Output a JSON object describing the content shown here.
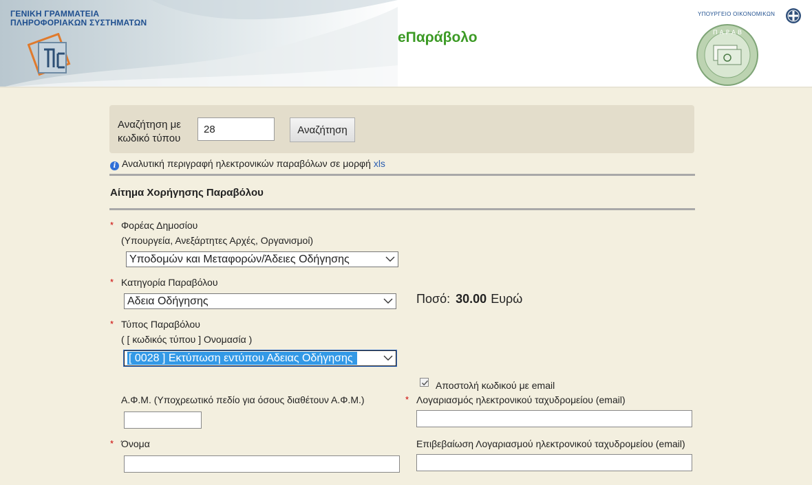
{
  "header": {
    "gsis_line1": "ΓΕΝΙΚΗ ΓΡΑΜΜΑΤΕΙΑ",
    "gsis_line2": "ΠΛΗΡΟΦΟΡΙΑΚΩΝ ΣΥΣΤΗΜΑΤΩΝ",
    "app_title": "eΠαράβολο",
    "ministry": "ΥΠΟΥΡΓΕΙΟ ΟΙΚΟΝΟΜΙΚΩΝ"
  },
  "search": {
    "label_line1": "Αναζήτηση με",
    "label_line2": "κωδικό τύπου",
    "value": "28",
    "button": "Αναζήτηση"
  },
  "info": {
    "text": "Αναλυτική περιγραφή ηλεκτρονικών παραβόλων σε μορφή",
    "link": "xls"
  },
  "section_title": "Αίτημα Χορήγησης Παραβόλου",
  "form": {
    "agency": {
      "label": "Φορέας Δημοσίου",
      "hint": "(Υπουργεία, Ανεξάρτητες Αρχές, Οργανισμοί)",
      "value": "Υποδομών και Μεταφορών/Άδειες Οδήγησης"
    },
    "category": {
      "label": "Κατηγορία Παραβόλου",
      "value": "Αδεια Οδήγησης"
    },
    "amount": {
      "label": "Ποσό:",
      "value": "30.00",
      "currency": "Ευρώ"
    },
    "type": {
      "label": "Τύπος Παραβόλου",
      "hint": "( [ κωδικός τύπου ] Ονομασία )",
      "value": "[ 0028 ] Εκτύπωση εντύπου Αδειας Οδήγησης"
    },
    "send_email": {
      "label": "Αποστολή κωδικού με email",
      "checked": true
    },
    "afm": {
      "label": "Α.Φ.Μ. (Υποχρεωτικό πεδίο για όσους διαθέτουν Α.Φ.Μ.)",
      "value": ""
    },
    "email": {
      "label": "Λογαριασμός ηλεκτρονικού ταχυδρομείου (email)",
      "value": ""
    },
    "name": {
      "label": "Όνομα",
      "value": ""
    },
    "email_confirm": {
      "label": "Επιβεβαίωση Λογαριασμού ηλεκτρονικού ταχυδρομείου (email)",
      "value": ""
    },
    "required_marker": "*"
  }
}
